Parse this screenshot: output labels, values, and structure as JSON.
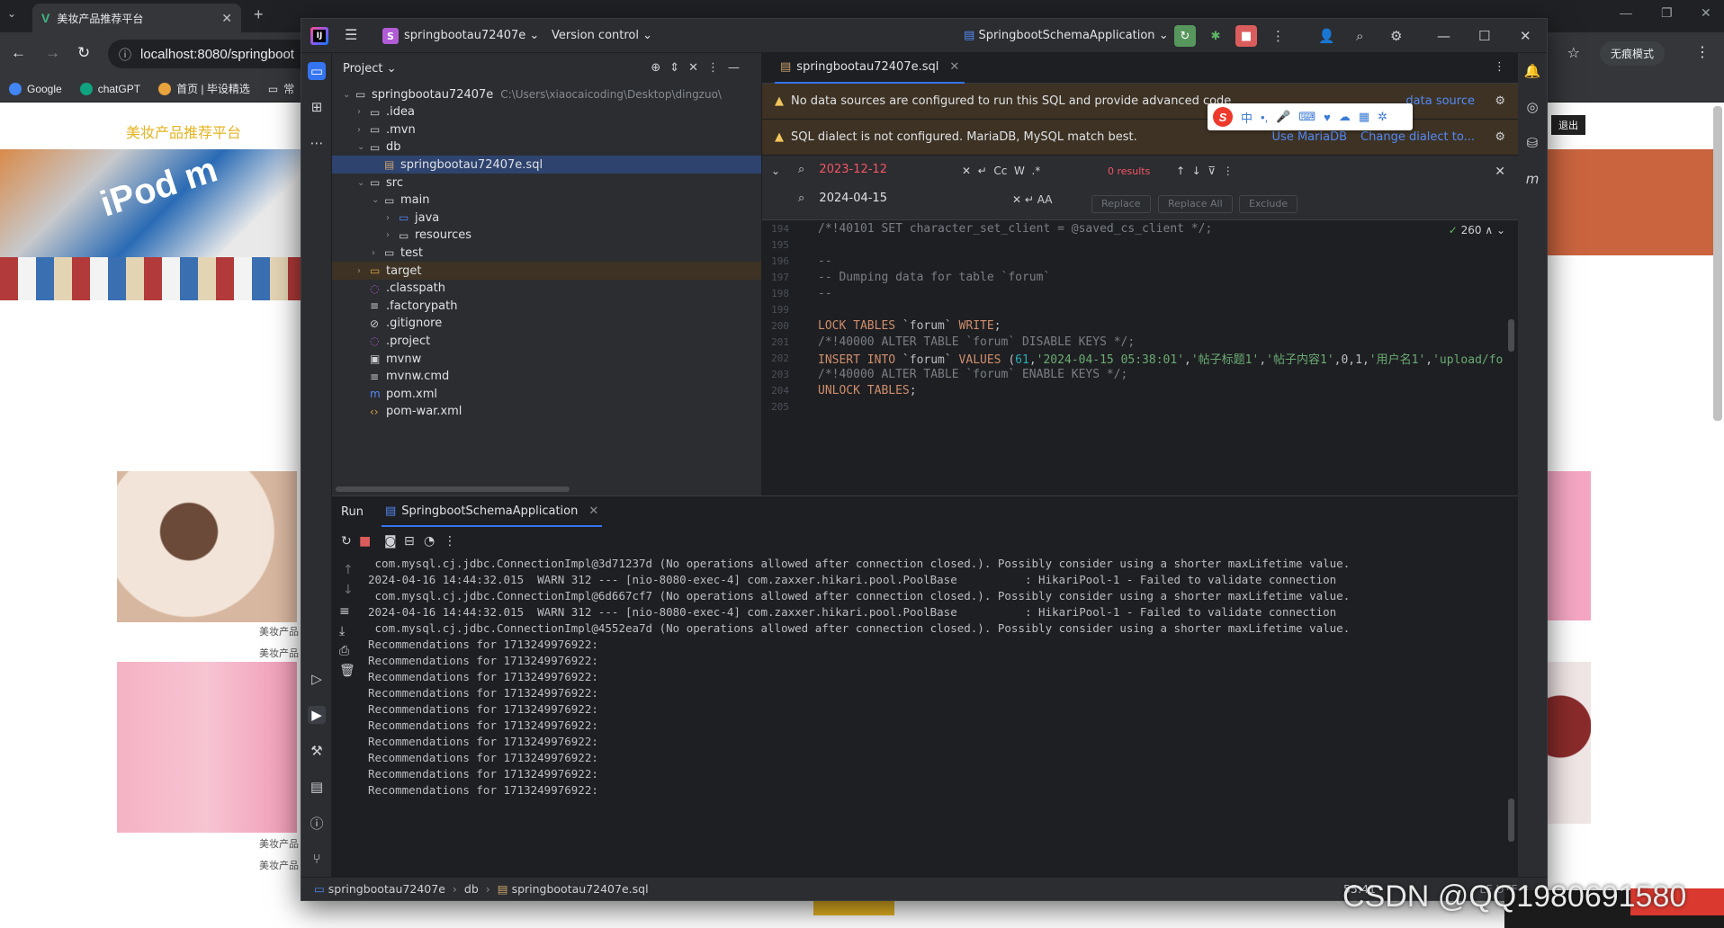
{
  "browser": {
    "tab_title": "美妆产品推荐平台",
    "url": "localhost:8080/springboot",
    "incognito_label": "无痕模式",
    "bookmarks": [
      "Google",
      "chatGPT",
      "首页 | 毕设精选",
      "常"
    ]
  },
  "webpage": {
    "site_title": "美妆产品推荐平台",
    "logout": "退出",
    "card_labels": [
      "美妆产品",
      "美妆产品",
      "美妆产品",
      "美妆产品"
    ]
  },
  "ide": {
    "project_name": "springbootau72407e",
    "vcs": "Version control",
    "run_config": "SpringbootSchemaApplication",
    "project_panel_title": "Project",
    "tree": [
      {
        "name": "springbootau72407e",
        "path": "C:\\Users\\xiaocaicoding\\Desktop\\dingzuo\\",
        "arrow": "v",
        "icon": "folder",
        "indent": 0
      },
      {
        "name": ".idea",
        "arrow": ">",
        "icon": "folder",
        "indent": 1
      },
      {
        "name": ".mvn",
        "arrow": ">",
        "icon": "folder",
        "indent": 1
      },
      {
        "name": "db",
        "arrow": "v",
        "icon": "folder",
        "indent": 1
      },
      {
        "name": "springbootau72407e.sql",
        "arrow": "",
        "icon": "sql-file",
        "indent": 2,
        "selected": true
      },
      {
        "name": "src",
        "arrow": "v",
        "icon": "folder",
        "indent": 1
      },
      {
        "name": "main",
        "arrow": "v",
        "icon": "folder",
        "indent": 2
      },
      {
        "name": "java",
        "arrow": ">",
        "icon": "source-folder",
        "indent": 3
      },
      {
        "name": "resources",
        "arrow": ">",
        "icon": "resources-folder",
        "indent": 3
      },
      {
        "name": "test",
        "arrow": ">",
        "icon": "folder",
        "indent": 2
      },
      {
        "name": "target",
        "arrow": ">",
        "icon": "excluded-folder",
        "indent": 1,
        "excluded": true
      },
      {
        "name": ".classpath",
        "arrow": "",
        "icon": "file",
        "indent": 1
      },
      {
        "name": ".factorypath",
        "arrow": "",
        "icon": "text-file",
        "indent": 1
      },
      {
        "name": ".gitignore",
        "arrow": "",
        "icon": "ignore-file",
        "indent": 1
      },
      {
        "name": ".project",
        "arrow": "",
        "icon": "file",
        "indent": 1
      },
      {
        "name": "mvnw",
        "arrow": "",
        "icon": "script-file",
        "indent": 1
      },
      {
        "name": "mvnw.cmd",
        "arrow": "",
        "icon": "text-file",
        "indent": 1
      },
      {
        "name": "pom.xml",
        "arrow": "",
        "icon": "maven-file",
        "indent": 1
      },
      {
        "name": "pom-war.xml",
        "arrow": "",
        "icon": "xml-file",
        "indent": 1
      }
    ],
    "editor": {
      "tab": "springbootau72407e.sql",
      "banner1": "No data sources are configured to run this SQL and provide advanced code",
      "banner1_link": "data source",
      "banner2": "SQL dialect is not configured. MariaDB, MySQL match best.",
      "banner2_link1": "Use MariaDB",
      "banner2_link2": "Change dialect to...",
      "search_value": "2023-12-12",
      "results": "0 results",
      "replace_value": "2024-04-15",
      "replace_btn": "Replace",
      "replace_all_btn": "Replace All",
      "exclude_btn": "Exclude",
      "inspections": "260",
      "lines": [
        {
          "num": "194",
          "parts": [
            {
              "t": "/*!40101 SET character_set_client = @saved_cs_client */;",
              "c": "c-cmt"
            }
          ]
        },
        {
          "num": "195",
          "parts": []
        },
        {
          "num": "196",
          "parts": [
            {
              "t": "--",
              "c": "c-cmt"
            }
          ]
        },
        {
          "num": "197",
          "parts": [
            {
              "t": "-- Dumping data for table `forum`",
              "c": "c-cmt"
            }
          ]
        },
        {
          "num": "198",
          "parts": [
            {
              "t": "--",
              "c": "c-cmt"
            }
          ]
        },
        {
          "num": "199",
          "parts": []
        },
        {
          "num": "200",
          "parts": [
            {
              "t": "LOCK TABLES ",
              "c": "c-kw"
            },
            {
              "t": "`forum` ",
              "c": "c-txt"
            },
            {
              "t": "WRITE",
              "c": "c-kw"
            },
            {
              "t": ";",
              "c": "c-txt"
            }
          ]
        },
        {
          "num": "201",
          "parts": [
            {
              "t": "/*!40000 ALTER TABLE `forum` DISABLE KEYS */;",
              "c": "c-cmt"
            }
          ]
        },
        {
          "num": "202",
          "parts": [
            {
              "t": "INSERT INTO ",
              "c": "c-kw"
            },
            {
              "t": "`forum` ",
              "c": "c-txt"
            },
            {
              "t": "VALUES ",
              "c": "c-kw"
            },
            {
              "t": "(",
              "c": "c-txt"
            },
            {
              "t": "61",
              "c": "c-num"
            },
            {
              "t": ",",
              "c": "c-txt"
            },
            {
              "t": "'2024-04-15 05:38:01'",
              "c": "c-str"
            },
            {
              "t": ",",
              "c": "c-txt"
            },
            {
              "t": "'帖子标题1'",
              "c": "c-str"
            },
            {
              "t": ",",
              "c": "c-txt"
            },
            {
              "t": "'帖子内容1'",
              "c": "c-str"
            },
            {
              "t": ",0,1,",
              "c": "c-txt"
            },
            {
              "t": "'用户名1'",
              "c": "c-str"
            },
            {
              "t": ",",
              "c": "c-txt"
            },
            {
              "t": "'upload/fo",
              "c": "c-str"
            }
          ]
        },
        {
          "num": "203",
          "parts": [
            {
              "t": "/*!40000 ALTER TABLE `forum` ENABLE KEYS */;",
              "c": "c-cmt"
            }
          ]
        },
        {
          "num": "204",
          "parts": [
            {
              "t": "UNLOCK TABLES",
              "c": "c-kw"
            },
            {
              "t": ";",
              "c": "c-txt"
            }
          ]
        },
        {
          "num": "205",
          "parts": []
        }
      ]
    },
    "run": {
      "tab_run": "Run",
      "tab_app": "SpringbootSchemaApplication",
      "console": [
        " com.mysql.cj.jdbc.ConnectionImpl@3d71237d (No operations allowed after connection closed.). Possibly consider using a shorter maxLifetime value.",
        "2024-04-16 14:44:32.015  WARN 312 --- [nio-8080-exec-4] com.zaxxer.hikari.pool.PoolBase          : HikariPool-1 - Failed to validate connection",
        " com.mysql.cj.jdbc.ConnectionImpl@6d667cf7 (No operations allowed after connection closed.). Possibly consider using a shorter maxLifetime value.",
        "2024-04-16 14:44:32.015  WARN 312 --- [nio-8080-exec-4] com.zaxxer.hikari.pool.PoolBase          : HikariPool-1 - Failed to validate connection",
        " com.mysql.cj.jdbc.ConnectionImpl@4552ea7d (No operations allowed after connection closed.). Possibly consider using a shorter maxLifetime value.",
        "Recommendations for 1713249976922:",
        "Recommendations for 1713249976922:",
        "Recommendations for 1713249976922:",
        "Recommendations for 1713249976922:",
        "Recommendations for 1713249976922:",
        "Recommendations for 1713249976922:",
        "Recommendations for 1713249976922:",
        "Recommendations for 1713249976922:",
        "Recommendations for 1713249976922:",
        "Recommendations for 1713249976922:"
      ]
    },
    "status": {
      "crumbs": [
        "springbootau72407e",
        "db",
        "springbootau72407e.sql"
      ],
      "position": "55:41",
      "rest": "LF  UTF-8"
    }
  },
  "ime": {
    "logo": "S",
    "mode": "中"
  },
  "watermark": "CSDN @QQ1980691580"
}
